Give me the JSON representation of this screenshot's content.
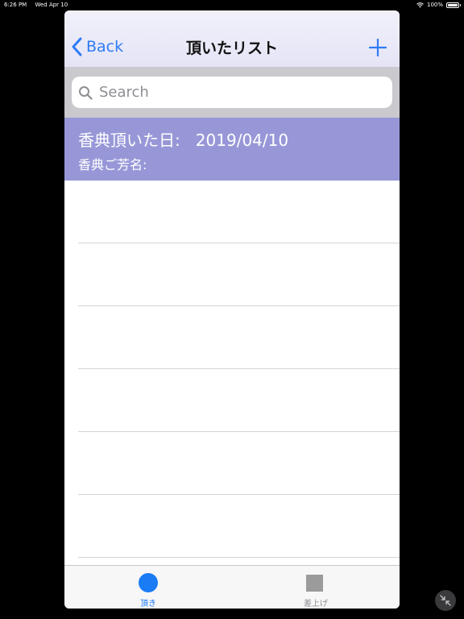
{
  "status_bar": {
    "time": "6:26 PM",
    "date": "Wed Apr 10",
    "battery": "100%"
  },
  "nav": {
    "back_label": "Back",
    "title": "頂いたリスト"
  },
  "search": {
    "placeholder": "Search"
  },
  "list": {
    "items": [
      {
        "line1": "香典頂いた日:   2019/04/10",
        "line2": "香典ご芳名:"
      }
    ]
  },
  "tabs": [
    {
      "label": "頂き",
      "icon": "circle-icon",
      "active": true
    },
    {
      "label": "差上げ",
      "icon": "square-icon",
      "active": false
    }
  ],
  "colors": {
    "accent": "#1a7cf5",
    "selected_row": "#9797d8",
    "nav_bar": "#e8e8f8",
    "search_bg": "#c9c9ce"
  }
}
